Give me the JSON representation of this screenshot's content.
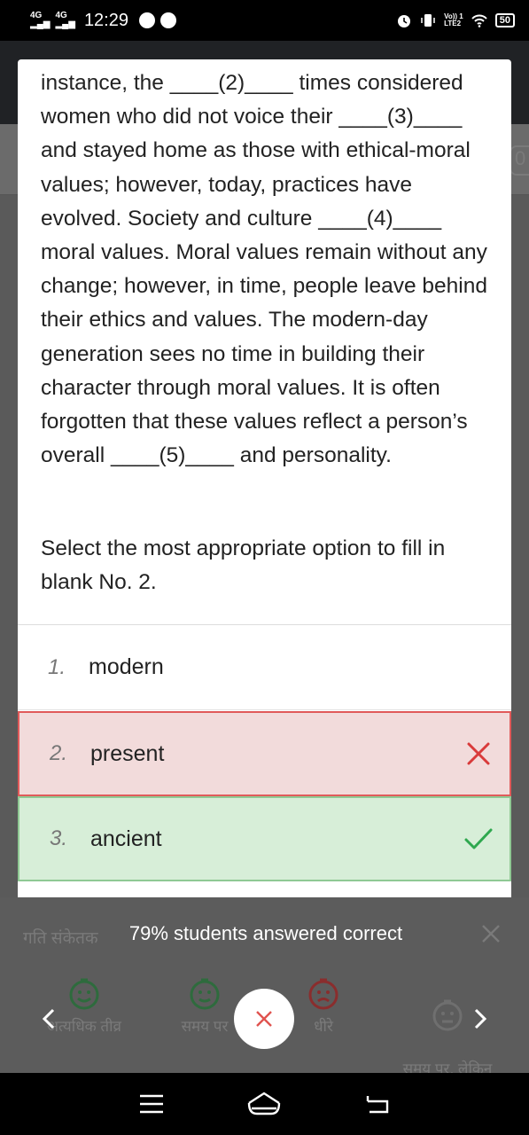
{
  "status_bar": {
    "net1": "4G",
    "net2": "4G",
    "time": "12:29",
    "volte": "Vo)) 1\nLTE2",
    "battery": "50"
  },
  "background": {
    "badge": "0"
  },
  "passage": {
    "text": "instance, the ____(2)____ times considered women who did not voice their ____(3)____ and stayed home as those with ethical-moral values; however, today, practices have evolved. Society and culture ____(4)____ moral values. Moral values remain without any change; however, in time, people leave behind their ethics and values. The modern-day generation sees no time in building their character through moral values. It is often forgotten that these values reflect a person’s overall ____(5)____ and personality."
  },
  "question": "Select the most appropriate option to fill in blank No. 2.",
  "options": [
    {
      "num": "1.",
      "label": "modern",
      "state": "neutral"
    },
    {
      "num": "2.",
      "label": "present",
      "state": "wrong",
      "mark_icon": "cross-icon"
    },
    {
      "num": "3.",
      "label": "ancient",
      "state": "correct",
      "mark_icon": "check-icon"
    }
  ],
  "colors": {
    "wrong_bg": "#f2dbdb",
    "wrong_border": "#e05a5a",
    "correct_bg": "#d7eed8",
    "correct_border": "#8fc994",
    "wrong_icon": "#d93a3a",
    "correct_icon": "#2fa84f"
  },
  "bottom_panel": {
    "title": "गति संकेतक",
    "feedback": "79% students answered correct",
    "speed_labels": [
      "अत्यधिक तीव्र",
      "समय पर",
      "धीरे",
      "समय पर, लेकिन\nसही नहीं"
    ]
  }
}
